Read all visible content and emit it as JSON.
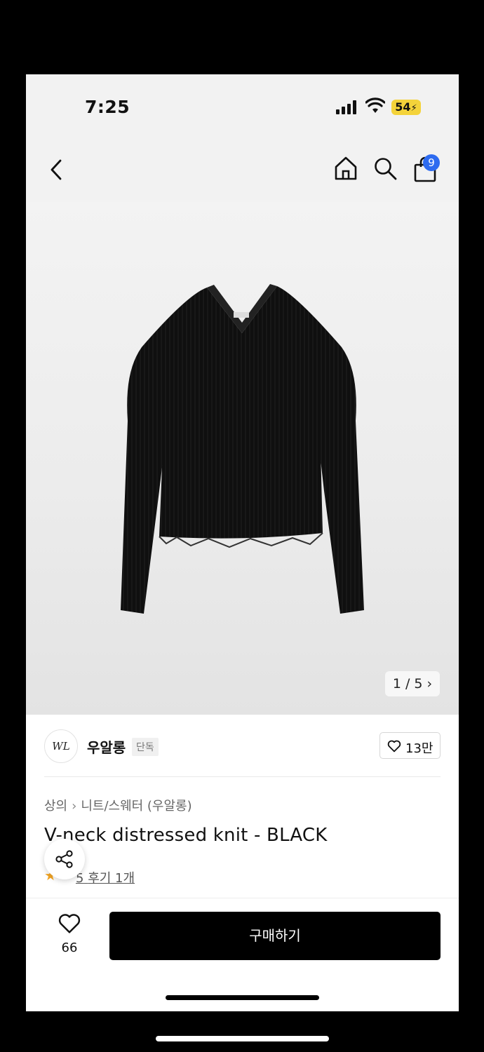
{
  "status_bar": {
    "time": "7:25",
    "battery": "54"
  },
  "nav": {
    "icons": [
      "back-icon",
      "home-icon",
      "search-icon",
      "shopping-bag-icon"
    ],
    "cart_count": "9"
  },
  "gallery": {
    "pager": "1 / 5 ›"
  },
  "brand": {
    "logo_text": "WL",
    "name": "우알롱",
    "exclusive_tag": "단독",
    "likes": "13만"
  },
  "breadcrumb": {
    "category": "상의",
    "subcategory": "니트/스웨터 (우알롱)"
  },
  "product": {
    "title": "V-neck distressed knit - BLACK",
    "rating": "5",
    "reviews": "후기 1개"
  },
  "bottom_bar": {
    "wish_count": "66",
    "buy_label": "구매하기"
  },
  "colors": {
    "accent_badge": "#2d6bf0",
    "battery": "#f4d33a",
    "buy_button": "#000000",
    "star": "#f5a623"
  }
}
